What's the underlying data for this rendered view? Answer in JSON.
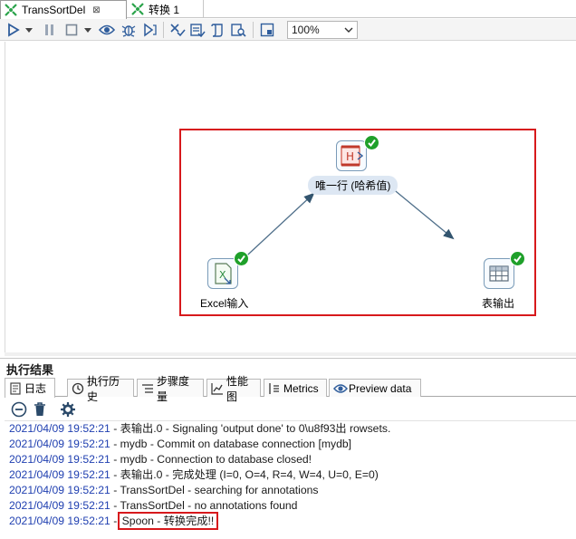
{
  "tabs": [
    {
      "label": "TransSortDel",
      "active": true,
      "close": "⊠"
    },
    {
      "label": "转换 1",
      "active": false
    }
  ],
  "toolbar": {
    "zoom": "100%"
  },
  "canvas": {
    "steps": {
      "unique": {
        "label": "唯一行 (哈希值)",
        "status": "ok"
      },
      "excel": {
        "label": "Excel输入",
        "status": "ok"
      },
      "table": {
        "label": "表输出",
        "status": "ok"
      }
    }
  },
  "results": {
    "title": "执行结果",
    "tabs": [
      "日志",
      "执行历史",
      "步骤度量",
      "性能图",
      "Metrics",
      "Preview data"
    ],
    "log": [
      {
        "ts": "2021/04/09 19:52:21",
        "msg": " - 表输出.0 - Signaling 'output done' to 0\\u8f93出 rowsets."
      },
      {
        "ts": "2021/04/09 19:52:21",
        "msg": " - mydb - Commit on database connection [mydb]"
      },
      {
        "ts": "2021/04/09 19:52:21",
        "msg": " - mydb - Connection to database closed!"
      },
      {
        "ts": "2021/04/09 19:52:21",
        "msg": " - 表输出.0 - 完成处理 (I=0, O=4, R=4, W=4, U=0, E=0)"
      },
      {
        "ts": "2021/04/09 19:52:21",
        "msg": " - TransSortDel - searching for annotations"
      },
      {
        "ts": "2021/04/09 19:52:21",
        "msg": " - TransSortDel - no annotations found"
      },
      {
        "ts": "2021/04/09 19:52:21",
        "msg_prefix": " - ",
        "msg": "Spoon - 转换完成!!"
      }
    ]
  },
  "colors": {
    "highlight_red": "#d7191c",
    "ok_green": "#1fa02a",
    "timestamp_blue": "#1f3fb0"
  }
}
